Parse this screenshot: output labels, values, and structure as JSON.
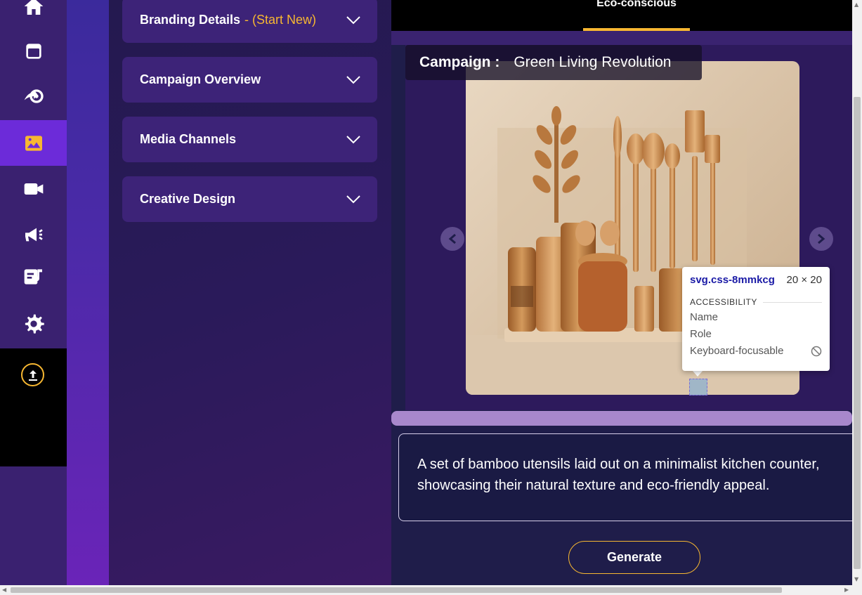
{
  "sidebar": {
    "items": [
      {
        "icon": "home-icon"
      },
      {
        "icon": "calendar-icon"
      },
      {
        "icon": "share-settings-icon"
      },
      {
        "icon": "image-icon",
        "active": true
      },
      {
        "icon": "video-icon"
      },
      {
        "icon": "megaphone-icon"
      },
      {
        "icon": "music-note-icon"
      },
      {
        "icon": "gear-icon"
      }
    ],
    "upload_icon": "upload-icon"
  },
  "accordion": {
    "branding": {
      "label": "Branding Details",
      "suffix": "- (Start New)"
    },
    "campaign_overview": {
      "label": "Campaign Overview"
    },
    "media_channels": {
      "label": "Media Channels"
    },
    "creative_design": {
      "label": "Creative Design"
    }
  },
  "main": {
    "tab_label": "Eco-conscious",
    "campaign_label": "Campaign :",
    "campaign_name": "Green Living Revolution",
    "description": "A set of bamboo utensils laid out on a minimalist kitchen counter, showcasing their natural texture and eco-friendly appeal.",
    "generate_label": "Generate"
  },
  "devtools_tooltip": {
    "selector_tag": "svg",
    "selector_class": ".css-8mmkcg",
    "dimensions": "20 × 20",
    "section": "ACCESSIBILITY",
    "rows": [
      "Name",
      "Role",
      "Keyboard-focusable"
    ]
  },
  "colors": {
    "accent": "#f7b731",
    "active_nav": "#6c2bd9",
    "panel_bg": "#3d2378"
  }
}
